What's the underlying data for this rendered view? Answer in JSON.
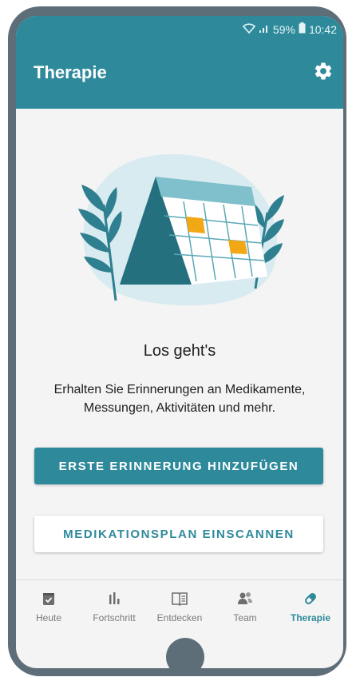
{
  "status_bar": {
    "battery": "59%",
    "time": "10:42"
  },
  "app_bar": {
    "title": "Therapie",
    "settings_icon": "gear-icon"
  },
  "empty_state": {
    "heading": "Los geht's",
    "line1": "Erhalten Sie Erinnerungen an Medikamente,",
    "line2": "Messungen, Aktivitäten und mehr."
  },
  "actions": {
    "primary_label": "ERSTE ERINNERUNG HINZUFÜGEN",
    "secondary_label": "MEDIKATIONSPLAN EINSCANNEN"
  },
  "bottom_nav": {
    "items": [
      {
        "label": "Heute",
        "icon": "calendar-check-icon",
        "active": false
      },
      {
        "label": "Fortschritt",
        "icon": "bar-chart-icon",
        "active": false
      },
      {
        "label": "Entdecken",
        "icon": "book-icon",
        "active": false
      },
      {
        "label": "Team",
        "icon": "people-icon",
        "active": false
      },
      {
        "label": "Therapie",
        "icon": "pill-icon",
        "active": true
      }
    ]
  },
  "colors": {
    "accent": "#2e8a9b",
    "frame": "#5d6e79",
    "highlight": "#f2a814"
  }
}
